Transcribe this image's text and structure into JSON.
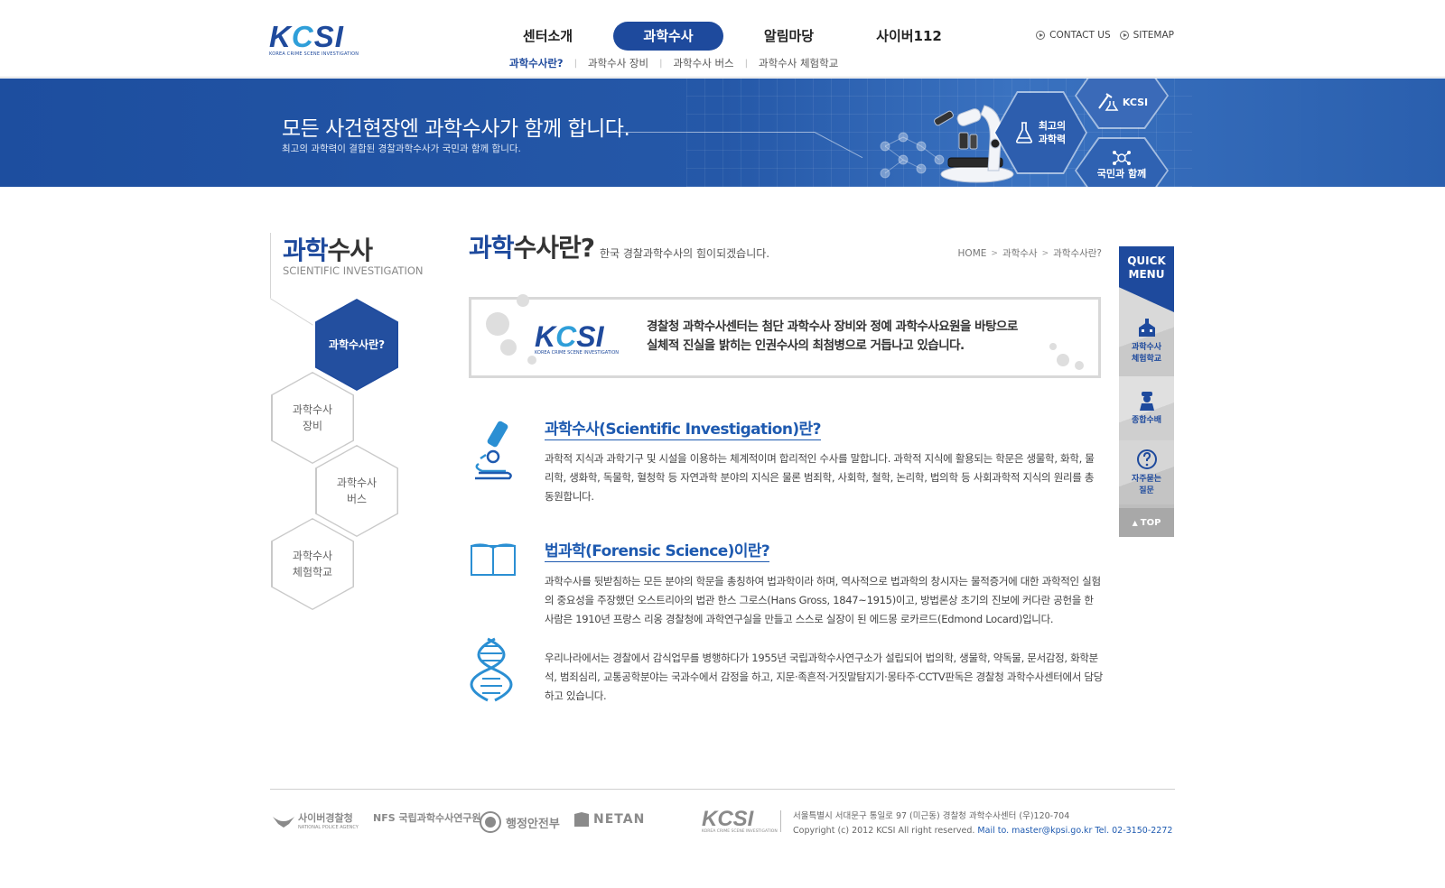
{
  "header": {
    "logo_text": "KCSI",
    "logo_sub": "KOREA CRIME SCENE INVESTIGATION",
    "gnb": [
      {
        "label": "센터소개",
        "active": false
      },
      {
        "label": "과학수사",
        "active": true
      },
      {
        "label": "알림마당",
        "active": false
      },
      {
        "label": "사이버112",
        "active": false
      }
    ],
    "snb": [
      {
        "label": "과학수사란?",
        "active": true
      },
      {
        "label": "과학수사 장비",
        "active": false
      },
      {
        "label": "과학수사 버스",
        "active": false
      },
      {
        "label": "과학수사 체험학교",
        "active": false
      }
    ],
    "util": {
      "contact": "CONTACT US",
      "sitemap": "SITEMAP"
    }
  },
  "banner": {
    "title": "모든 사건현장엔 과학수사가 함께 합니다.",
    "subtitle": "최고의 과학력이 결합된 경찰과학수사가 국민과 함께 합니다.",
    "hex_kcsi": "KCSI",
    "hex_best_1": "최고의",
    "hex_best_2": "과학력",
    "hex_people": "국민과 함께"
  },
  "lnb": {
    "title_blue": "과학",
    "title_rest": "수사",
    "title_en": "SCIENTIFIC INVESTIGATION",
    "items": [
      {
        "line1": "과학수사란?",
        "line2": "",
        "active": true
      },
      {
        "line1": "과학수사",
        "line2": "장비",
        "active": false
      },
      {
        "line1": "과학수사",
        "line2": "버스",
        "active": false
      },
      {
        "line1": "과학수사",
        "line2": "체험학교",
        "active": false
      }
    ]
  },
  "content": {
    "title_blue": "과학",
    "title_rest": "수사란?",
    "desc": "한국 경찰과학수사의 힘이되겠습니다.",
    "breadcrumb": [
      "HOME",
      "과학수사",
      "과학수사란?"
    ],
    "intro_logo": "KCSI",
    "intro_logo_sub": "KOREA CRIME SCENE INVESTIGATION",
    "intro_line1": "경찰청 과학수사센터는 첨단 과학수사 장비와 정예 과학수사요원을 바탕으로",
    "intro_line2": "실체적 진실을 밝히는 인권수사의 최첨병으로 거듭나고 있습니다.",
    "sec1_title": "과학수사(Scientific Investigation)란?",
    "sec1_para": "과학적 지식과 과학기구 및 시설을 이용하는 체계적이며 합리적인 수사를 말합니다. 과학적 지식에 활용되는 학문은 생물학, 화학, 물리학, 생화학, 독물학, 혈청학 등 자연과학 분야의 지식은 물론 범죄학, 사회학, 철학, 논리학, 법의학 등 사회과학적 지식의 원리를 총동원합니다.",
    "sec2_title": "법과학(Forensic Science)이란?",
    "sec2_para1": "과학수사를 뒷받침하는 모든 분야의 학문을 총칭하여 법과학이라 하며, 역사적으로 법과학의 창시자는 물적증거에 대한 과학적인 실험의 중요성을 주장했던 오스트리아의 법관 한스 그로스(Hans Gross, 1847~1915)이고, 방법론상 초기의 진보에 커다란 공헌을 한 사람은 1910년 프랑스 리옹 경찰청에 과학연구실을 만들고 스스로 실장이 된 에드몽 로카르드(Edmond Locard)입니다.",
    "sec2_para2": "우리나라에서는 경찰에서 감식업무를 병행하다가 1955년 국립과학수사연구소가 설립되어 법의학, 생물학, 약독물, 문서감정, 화학분석, 범죄심리, 교통공학분야는 국과수에서 감정을 하고, 지문·족흔적·거짓말탐지기·몽타주·CCTV판독은 경찰청 과학수사센터에서 담당하고 있습니다."
  },
  "quick": {
    "head1": "QUICK",
    "head2": "MENU",
    "items": [
      {
        "line1": "과학수사",
        "line2": "체험학교",
        "icon": "building-icon"
      },
      {
        "line1": "종합수배",
        "line2": "",
        "icon": "officer-icon"
      },
      {
        "line1": "자주묻는",
        "line2": "질문",
        "icon": "question-icon"
      }
    ],
    "top": "TOP"
  },
  "footer": {
    "logo1": "사이버경찰청",
    "logo1_sub": "NATIONAL POLICE AGENCY",
    "logo2": "NFS 국립과학수사연구원",
    "logo3": "행정안전부",
    "logo4": "NETAN",
    "logo5": "KCSI",
    "logo5_sub": "KOREA CRIME SCENE INVESTIGATION",
    "address": "서울특별시 서대문구 통일로 97 (미근동) 경찰청 과학수사센터 (우)120-704",
    "copyright": "Copyright (c) 2012 KCSI All right reserved.",
    "mail": "Mail to. master@kpsi.go.kr Tel. 02-3150-2272"
  },
  "colors": {
    "brand_blue": "#1e4a9d",
    "accent_blue": "#1e5ab0",
    "logo_cyan": "#2f9fd9"
  }
}
